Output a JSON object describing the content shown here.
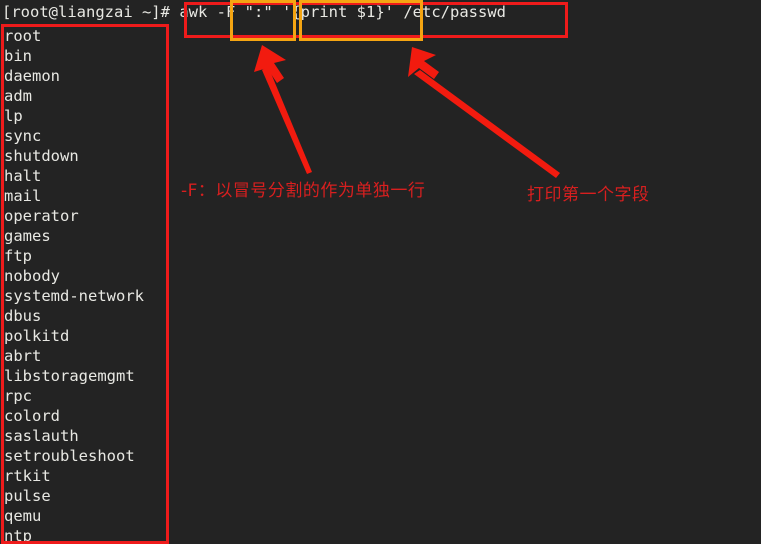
{
  "terminal": {
    "background_color": "#232323",
    "foreground_color": "#e8e8e3",
    "prompt": "[root@liangzai ~]#",
    "command": "awk -F \":\" '{print $1}' /etc/passwd",
    "command_parts": {
      "program": "awk",
      "field_separator_option": "-F \":\"",
      "awk_program": "'{print $1}'",
      "file_path": "/etc/passwd"
    },
    "output_lines": [
      "root",
      "bin",
      "daemon",
      "adm",
      "lp",
      "sync",
      "shutdown",
      "halt",
      "mail",
      "operator",
      "games",
      "ftp",
      "nobody",
      "systemd-network",
      "dbus",
      "polkitd",
      "abrt",
      "libstoragemgmt",
      "rpc",
      "colord",
      "saslauth",
      "setroubleshoot",
      "rtkit",
      "pulse",
      "qemu",
      "ntp"
    ]
  },
  "annotations": {
    "colors": {
      "red": "#ee1b1b",
      "amber": "#f5a512",
      "note_text": "#d81f1f"
    },
    "note_field_separator": "-F：以冒号分割的作为单独一行",
    "note_print_first_field": "打印第一个字段",
    "boxes": [
      {
        "name": "command-box",
        "color": "#ee1b1b"
      },
      {
        "name": "field-separator-box",
        "color": "#f5a512"
      },
      {
        "name": "print-program-box",
        "color": "#f5a512"
      },
      {
        "name": "output-box",
        "color": "#ee1b1b"
      }
    ],
    "arrows": [
      {
        "name": "arrow-to-field-separator",
        "color": "#ee1b1b"
      },
      {
        "name": "arrow-to-print-program",
        "color": "#ee1b1b"
      }
    ]
  }
}
